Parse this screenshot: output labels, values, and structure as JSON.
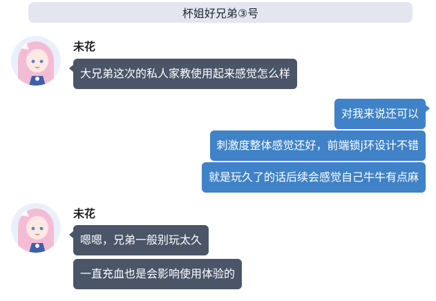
{
  "header": {
    "title": "杯姐好兄弟③号"
  },
  "groups": [
    {
      "sender": "未花",
      "messages": [
        "大兄弟这次的私人家教使用起来感觉怎么样"
      ]
    },
    {
      "sender": "me",
      "messages": [
        "对我来说还可以",
        "刺激度整体感觉还好，前端锁j环设计不错",
        "就是玩久了的话后续会感觉自己牛牛有点麻"
      ]
    },
    {
      "sender": "未花",
      "messages": [
        "嗯嗯，兄弟一般别玩太久",
        "一直充血也是会影响使用体验的"
      ]
    }
  ],
  "colors": {
    "incoming_bubble": "#4a5568",
    "outgoing_bubble": "#3f82c8",
    "header_bg": "#e3e6ee"
  }
}
